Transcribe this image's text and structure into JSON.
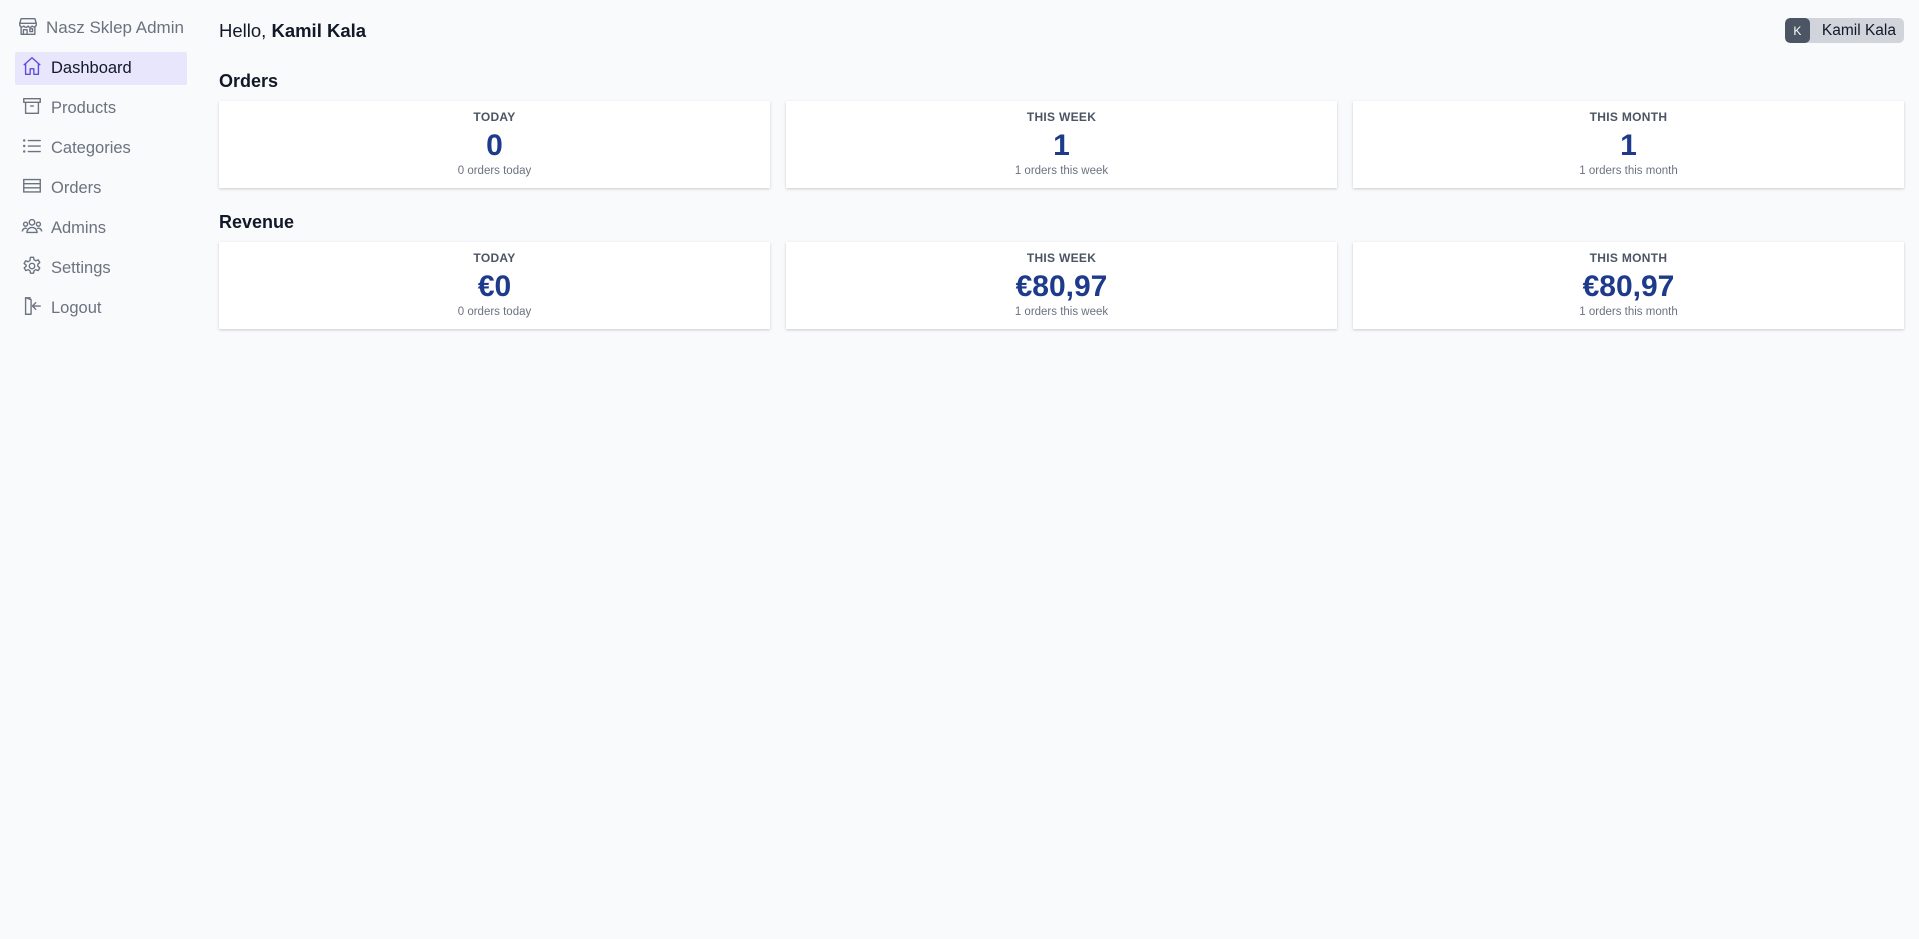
{
  "app": {
    "title": "Nasz Sklep Admin"
  },
  "sidebar": {
    "items": [
      {
        "label": "Dashboard",
        "icon": "home-icon",
        "active": true
      },
      {
        "label": "Products",
        "icon": "archive-icon"
      },
      {
        "label": "Categories",
        "icon": "list-icon"
      },
      {
        "label": "Orders",
        "icon": "stack-icon"
      },
      {
        "label": "Admins",
        "icon": "users-icon"
      },
      {
        "label": "Settings",
        "icon": "gear-icon"
      },
      {
        "label": "Logout",
        "icon": "logout-icon"
      }
    ]
  },
  "header": {
    "greeting_prefix": "Hello,",
    "user_name": "Kamil Kala",
    "avatar_initial": "K",
    "chip_name": "Kamil Kala"
  },
  "orders": {
    "title": "Orders",
    "cards": [
      {
        "label": "TODAY",
        "value": "0",
        "sub": "0 orders today"
      },
      {
        "label": "THIS WEEK",
        "value": "1",
        "sub": "1 orders this week"
      },
      {
        "label": "THIS MONTH",
        "value": "1",
        "sub": "1 orders this month"
      }
    ]
  },
  "revenue": {
    "title": "Revenue",
    "cards": [
      {
        "label": "TODAY",
        "value": "€0",
        "sub": "0 orders today"
      },
      {
        "label": "THIS WEEK",
        "value": "€80,97",
        "sub": "1 orders this week"
      },
      {
        "label": "THIS MONTH",
        "value": "€80,97",
        "sub": "1 orders this month"
      }
    ]
  },
  "colors": {
    "accent": "#5b4ddb",
    "active_bg": "#e8e6fd",
    "value": "#1e3a8a",
    "background": "#f9fafb"
  }
}
